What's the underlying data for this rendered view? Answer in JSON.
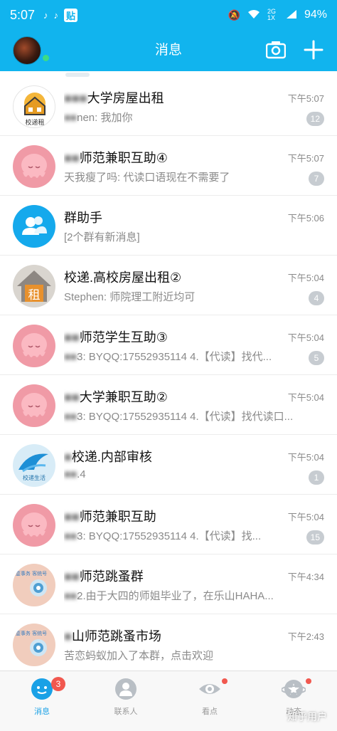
{
  "status_bar": {
    "time": "5:07",
    "app_badge": "贴",
    "network": "2G 1X",
    "battery": "94%"
  },
  "header": {
    "title": "消息"
  },
  "conversations": [
    {
      "name": "大学房屋出租",
      "preview": "nen: 我加你",
      "time": "下午5:07",
      "badge": "12",
      "avatar_icon": "house-logo-avatar",
      "avatar_text": "校递租"
    },
    {
      "name": "师范兼职互助④",
      "preview": "天我瘦了吗: 代读口语现在不需要了",
      "time": "下午5:07",
      "badge": "7",
      "avatar_icon": "octopus-avatar"
    },
    {
      "name": "群助手",
      "preview": "[2个群有新消息]",
      "time": "下午5:06",
      "badge": "",
      "avatar_icon": "group-helper-avatar"
    },
    {
      "name": "校递.高校房屋出租②",
      "preview": "Stephen: 师院理工附近均可",
      "time": "下午5:04",
      "badge": "4",
      "avatar_icon": "rent-house-avatar",
      "avatar_text": "租"
    },
    {
      "name": "师范学生互助③",
      "preview": "3: BYQQ:17552935114 4.【代读】找代...",
      "time": "下午5:04",
      "badge": "5",
      "avatar_icon": "octopus-avatar"
    },
    {
      "name": "大学兼职互助②",
      "preview": "3: BYQQ:17552935114 4.【代读】找代读口...",
      "time": "下午5:04",
      "badge": "",
      "avatar_icon": "octopus-avatar"
    },
    {
      "name": "校递.内部审核",
      "preview": ".4",
      "time": "下午5:04",
      "badge": "1",
      "avatar_icon": "wave-logo-avatar",
      "avatar_text": "校递生活"
    },
    {
      "name": "师范兼职互助",
      "preview": "3: BYQQ:17552935114 4.【代读】找...",
      "time": "下午5:04",
      "badge": "15",
      "avatar_icon": "octopus-avatar"
    },
    {
      "name": "师范跳蚤群",
      "preview": "2.由于大四的师姐毕业了，在乐山HAHA...",
      "time": "下午4:34",
      "badge": "",
      "avatar_icon": "flower-avatar",
      "avatar_text": "壹事务 客统号"
    },
    {
      "name": "山师范跳蚤市场",
      "preview": "苦恋蚂蚁加入了本群，点击欢迎",
      "time": "下午2:43",
      "badge": "",
      "avatar_icon": "flower-avatar",
      "avatar_text": "壹事务 客统号"
    }
  ],
  "tabs": [
    {
      "label": "消息",
      "icon": "message-bubble-icon",
      "badge": "3"
    },
    {
      "label": "联系人",
      "icon": "contact-person-icon"
    },
    {
      "label": "看点",
      "icon": "eye-icon"
    },
    {
      "label": "动态",
      "icon": "star-planet-icon"
    }
  ],
  "watermark": "知乎用户",
  "colors": {
    "accent": "#11b4ee",
    "badge_gray": "#c7ccd1",
    "notify_red": "#f1584f"
  }
}
